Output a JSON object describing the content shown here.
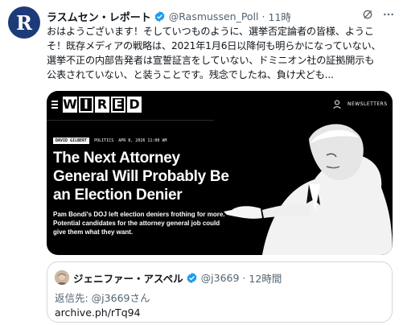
{
  "tweet": {
    "avatar_letter": "R",
    "display_name": "ラスムセン・レポート",
    "handle": "@Rasmussen_Poll",
    "separator": "·",
    "time": "11時",
    "text_lines": [
      "おはようございます！そしていつものように、選挙否定論者の皆様、ようこ",
      "そ！既存メディアの戦略は、2021年1月6日以降何も明らかになっていない、",
      "選挙不正の内部告発者は宣誓証言をしていない、ドミニオン社の証拠開示も",
      "公表されていない、と装うことです。残念でしたね、負け犬ども..."
    ],
    "icons": [
      "verified-icon",
      "grok-icon",
      "more-icon"
    ]
  },
  "article_card": {
    "logo_letters": [
      "W",
      "I",
      "R",
      "E",
      "D"
    ],
    "newsletters_label": "NEWSLETTERS",
    "author": "DAVID GILBERT",
    "section": "POLITICS",
    "date": "APR 8, 2026 11:00 AM",
    "headline": "The Next Attorney General Will Probably Be an Election Denier",
    "dek": "Pam Bondi's DOJ left election deniers frothing for more. Potential candidates for the attorney general job could give them what they want."
  },
  "quoted_tweet": {
    "display_name": "ジェニファー・アスペル",
    "handle": "@j3669",
    "separator": "·",
    "time": "12時間",
    "reply_to": "返信先: @j3669さん",
    "link": "archive.ph/rTq94"
  },
  "colors": {
    "verified": "#1d9bf0",
    "secondary_text": "#536471",
    "border": "#cfd9de"
  }
}
